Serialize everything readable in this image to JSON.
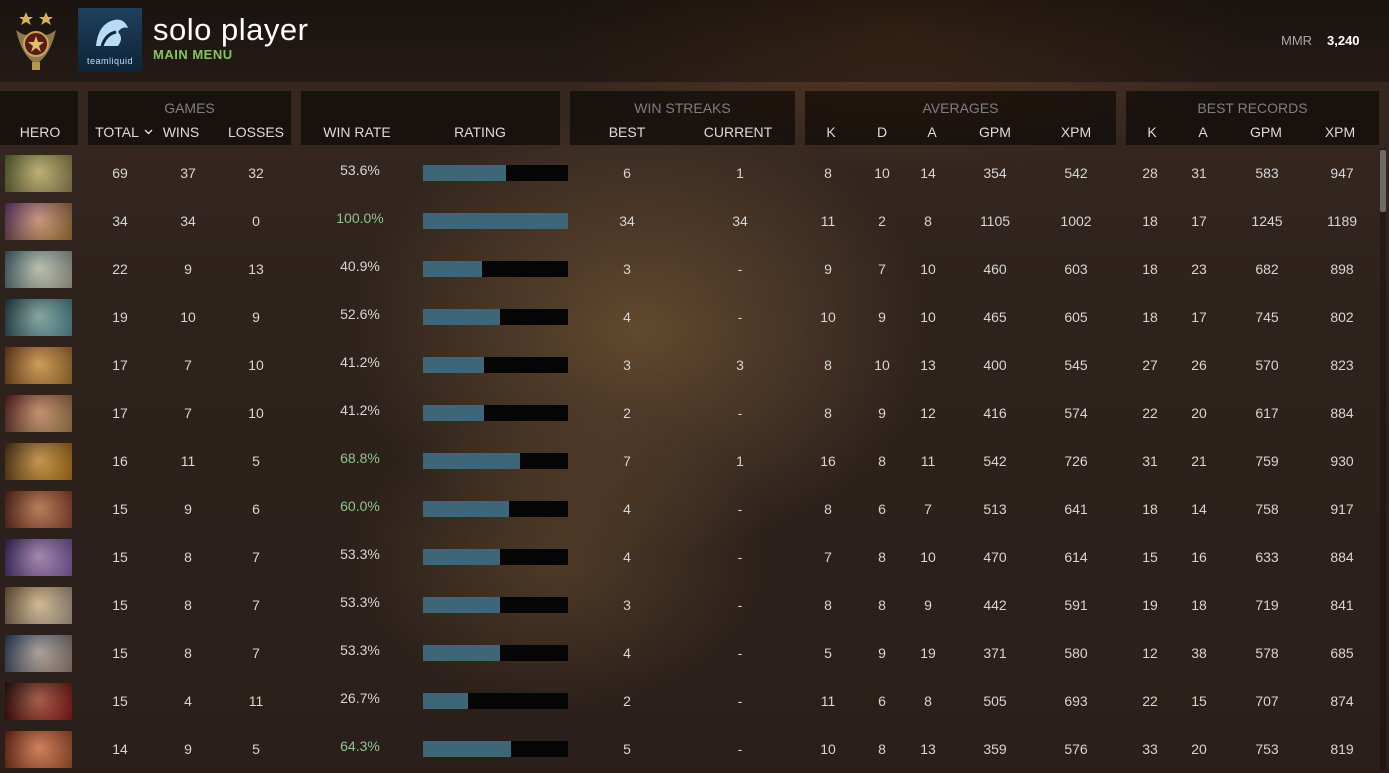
{
  "header": {
    "player_name": "solo player",
    "subtitle": "MAIN MENU",
    "team_logo_text": "teamliquid",
    "mmr_label": "MMR",
    "mmr_value": "3,240",
    "medal_icon": "rank-medal-icon"
  },
  "columns": {
    "hero": "HERO",
    "games_group": "GAMES",
    "total": "TOTAL",
    "wins": "WINS",
    "losses": "LOSSES",
    "win_rate": "WIN RATE",
    "rating": "RATING",
    "streaks_group": "WIN STREAKS",
    "best": "BEST",
    "current": "CURRENT",
    "averages_group": "AVERAGES",
    "avg_k": "K",
    "avg_d": "D",
    "avg_a": "A",
    "avg_gpm": "GPM",
    "avg_xpm": "XPM",
    "best_group": "BEST RECORDS",
    "best_k": "K",
    "best_a": "A",
    "best_gpm": "GPM",
    "best_xpm": "XPM"
  },
  "colors": {
    "accent_green": "#86c45a",
    "winrate_green": "#8fc58a",
    "rating_bar": "#3d6677",
    "rating_track": "#050505"
  },
  "rows": [
    {
      "total": "69",
      "wins": "37",
      "losses": "32",
      "win_rate": "53.6%",
      "rating": 0.57,
      "green": false,
      "best": "6",
      "current": "1",
      "k": "8",
      "d": "10",
      "a": "14",
      "gpm": "354",
      "xpm": "542",
      "bk": "28",
      "ba": "31",
      "bgpm": "583",
      "bxpm": "947",
      "portrait": [
        "#6a7a3a",
        "#c8b070"
      ]
    },
    {
      "total": "34",
      "wins": "34",
      "losses": "0",
      "win_rate": "100.0%",
      "rating": 1.0,
      "green": true,
      "best": "34",
      "current": "34",
      "k": "11",
      "d": "2",
      "a": "8",
      "gpm": "1105",
      "xpm": "1002",
      "bk": "18",
      "ba": "17",
      "bgpm": "1245",
      "bxpm": "1189",
      "portrait": [
        "#7a3f8a",
        "#d9a040"
      ]
    },
    {
      "total": "22",
      "wins": "9",
      "losses": "13",
      "win_rate": "40.9%",
      "rating": 0.41,
      "green": false,
      "best": "3",
      "current": "-",
      "k": "9",
      "d": "7",
      "a": "10",
      "gpm": "460",
      "xpm": "603",
      "bk": "18",
      "ba": "23",
      "bgpm": "682",
      "bxpm": "898",
      "portrait": [
        "#4a7a8a",
        "#e0e0d0"
      ]
    },
    {
      "total": "19",
      "wins": "10",
      "losses": "9",
      "win_rate": "52.6%",
      "rating": 0.53,
      "green": false,
      "best": "4",
      "current": "-",
      "k": "10",
      "d": "9",
      "a": "10",
      "gpm": "465",
      "xpm": "605",
      "bk": "18",
      "ba": "17",
      "bgpm": "745",
      "bxpm": "802",
      "portrait": [
        "#1f4a5a",
        "#70c0d0"
      ]
    },
    {
      "total": "17",
      "wins": "7",
      "losses": "10",
      "win_rate": "41.2%",
      "rating": 0.42,
      "green": false,
      "best": "3",
      "current": "3",
      "k": "8",
      "d": "10",
      "a": "13",
      "gpm": "400",
      "xpm": "545",
      "bk": "27",
      "ba": "26",
      "bgpm": "570",
      "bxpm": "823",
      "portrait": [
        "#8a4a1a",
        "#e0a040"
      ]
    },
    {
      "total": "17",
      "wins": "7",
      "losses": "10",
      "win_rate": "41.2%",
      "rating": 0.42,
      "green": false,
      "best": "2",
      "current": "-",
      "k": "8",
      "d": "9",
      "a": "12",
      "gpm": "416",
      "xpm": "574",
      "bk": "22",
      "ba": "20",
      "bgpm": "617",
      "bxpm": "884",
      "portrait": [
        "#6a1f2a",
        "#e0b070"
      ]
    },
    {
      "total": "16",
      "wins": "11",
      "losses": "5",
      "win_rate": "68.8%",
      "rating": 0.67,
      "green": true,
      "best": "7",
      "current": "1",
      "k": "16",
      "d": "8",
      "a": "11",
      "gpm": "542",
      "xpm": "726",
      "bk": "31",
      "ba": "21",
      "bgpm": "759",
      "bxpm": "930",
      "portrait": [
        "#5a3a1a",
        "#f0a020"
      ]
    },
    {
      "total": "15",
      "wins": "9",
      "losses": "6",
      "win_rate": "60.0%",
      "rating": 0.59,
      "green": true,
      "best": "4",
      "current": "-",
      "k": "8",
      "d": "6",
      "a": "7",
      "gpm": "513",
      "xpm": "641",
      "bk": "18",
      "ba": "14",
      "bgpm": "758",
      "bxpm": "917",
      "portrait": [
        "#6a2a1a",
        "#c06040"
      ]
    },
    {
      "total": "15",
      "wins": "8",
      "losses": "7",
      "win_rate": "53.3%",
      "rating": 0.53,
      "green": false,
      "best": "4",
      "current": "-",
      "k": "7",
      "d": "8",
      "a": "10",
      "gpm": "470",
      "xpm": "614",
      "bk": "15",
      "ba": "16",
      "bgpm": "633",
      "bxpm": "884",
      "portrait": [
        "#3a2a7a",
        "#b080e0"
      ]
    },
    {
      "total": "15",
      "wins": "8",
      "losses": "7",
      "win_rate": "53.3%",
      "rating": 0.53,
      "green": false,
      "best": "3",
      "current": "-",
      "k": "8",
      "d": "8",
      "a": "9",
      "gpm": "442",
      "xpm": "591",
      "bk": "19",
      "ba": "18",
      "bgpm": "719",
      "bxpm": "841",
      "portrait": [
        "#8a6a4a",
        "#e8d8c0"
      ]
    },
    {
      "total": "15",
      "wins": "8",
      "losses": "7",
      "win_rate": "53.3%",
      "rating": 0.53,
      "green": false,
      "best": "4",
      "current": "-",
      "k": "5",
      "d": "9",
      "a": "19",
      "gpm": "371",
      "xpm": "580",
      "bk": "12",
      "ba": "38",
      "bgpm": "578",
      "bxpm": "685",
      "portrait": [
        "#2a4a7a",
        "#d0b0a0"
      ]
    },
    {
      "total": "15",
      "wins": "4",
      "losses": "11",
      "win_rate": "26.7%",
      "rating": 0.31,
      "green": false,
      "best": "2",
      "current": "-",
      "k": "11",
      "d": "6",
      "a": "8",
      "gpm": "505",
      "xpm": "693",
      "bk": "22",
      "ba": "15",
      "bgpm": "707",
      "bxpm": "874",
      "portrait": [
        "#2a0a0a",
        "#c02020"
      ]
    },
    {
      "total": "14",
      "wins": "9",
      "losses": "5",
      "win_rate": "64.3%",
      "rating": 0.61,
      "green": true,
      "best": "5",
      "current": "-",
      "k": "10",
      "d": "8",
      "a": "13",
      "gpm": "359",
      "xpm": "576",
      "bk": "33",
      "ba": "20",
      "bgpm": "753",
      "bxpm": "819",
      "portrait": [
        "#8a2a1a",
        "#e07040"
      ]
    }
  ]
}
